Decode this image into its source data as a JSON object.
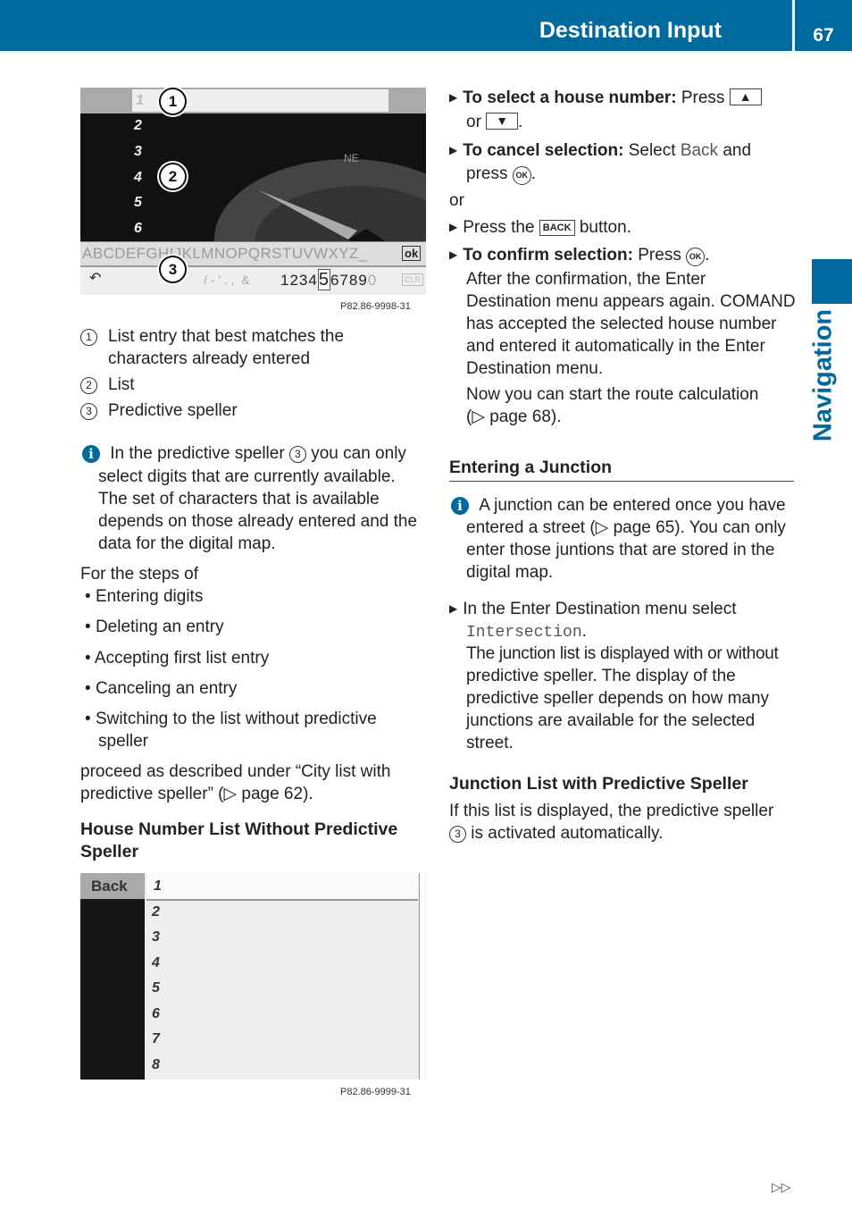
{
  "header": {
    "title": "Destination Input",
    "page_number": "67"
  },
  "side_tab": {
    "label": "Navigation",
    "color": "#006a9e"
  },
  "figure1": {
    "list_items": [
      "1",
      "2",
      "3",
      "4",
      "5",
      "6"
    ],
    "compass_label": "NE",
    "letters": "ABCDEFGHIJKLMNOPQRSTUVWXYZ_",
    "ok_label": "ok",
    "symbols": "/ - ' . ,  &",
    "digits_before": "1234",
    "digit_selected": "5",
    "digits_after": "6789",
    "digit_zero": "0",
    "clr_label": "CLR",
    "callouts": [
      "1",
      "2",
      "3"
    ],
    "code": "P82.86-9998-31"
  },
  "legend": [
    {
      "num": "1",
      "lines": [
        "List entry that best matches the",
        "characters already entered"
      ]
    },
    {
      "num": "2",
      "lines": [
        "List"
      ]
    },
    {
      "num": "3",
      "lines": [
        "Predictive speller"
      ]
    }
  ],
  "info1": {
    "pre": "In the predictive speller",
    "num": "3",
    "post": "you can only",
    "lines": [
      "select digits that are currently available.",
      "The set of characters that is available",
      "depends on those already entered and the",
      "data for the digital map."
    ]
  },
  "steps_intro": "For the steps of",
  "steps": [
    "Entering digits",
    "Deleting an entry",
    "Accepting first list entry",
    "Canceling an entry",
    "Switching to the list without predictive"
  ],
  "steps_cont": "speller",
  "proceed": [
    "proceed as described under “City list with",
    "predictive speller” (▷ page 62)."
  ],
  "heading_house": [
    "House Number List Without Predictive",
    "Speller"
  ],
  "figure2": {
    "back_label": "Back",
    "list_items": [
      "1",
      "2",
      "3",
      "4",
      "5",
      "6",
      "7",
      "8"
    ],
    "code": "P82.86-9999-31"
  },
  "right": {
    "select_bold": "To select a house number:",
    "select_text": "Press",
    "up_key": "▲",
    "or1": "or",
    "down_key": "▼",
    "cancel_bold": "To cancel selection:",
    "cancel_text": "Select",
    "cancel_back": "Back",
    "cancel_and": "and",
    "press": "press",
    "ok_key": "OK",
    "or2": "or",
    "press_the": "Press the",
    "back_key": "BACK",
    "button": "button.",
    "confirm_bold": "To confirm selection:",
    "confirm_text": "Press",
    "after": [
      "After the confirmation, the Enter",
      "Destination menu appears again. COMAND",
      "has accepted the selected house number",
      "and entered it automatically in the Enter",
      "Destination menu."
    ],
    "now": [
      "Now you can start the route calculation",
      "(▷ page 68)."
    ],
    "heading_junction": "Entering a Junction",
    "info2": [
      "A junction can be entered once you have",
      "entered a street (▷ page 65). You can only",
      "enter those juntions that are stored in the",
      "digital map."
    ],
    "menu_select": "In the Enter Destination menu select",
    "intersection": "Intersection",
    "junction_desc": [
      "The junction list is displayed with or without",
      "predictive speller. The display of the",
      "predictive speller depends on how many",
      "junctions are available for the selected",
      "street."
    ],
    "heading_list": "Junction List with Predictive Speller",
    "list_desc1": "If this list is displayed, the predictive speller",
    "list_num": "3",
    "list_desc2": "is activated automatically."
  },
  "footer": {
    "continue": "▷▷"
  }
}
